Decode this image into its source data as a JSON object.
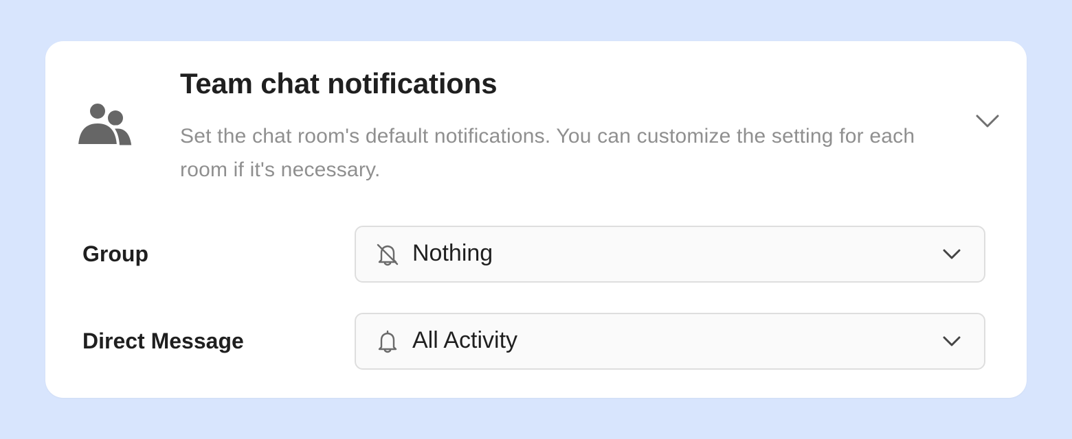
{
  "card": {
    "icon": "team-people-icon",
    "title": "Team chat notifications",
    "description": "Set the chat room's default notifications. You can customize the setting for each room if it's necessary.",
    "collapse_icon": "chevron-down-icon"
  },
  "settings": [
    {
      "label": "Group",
      "value": "Nothing",
      "icon": "bell-off-icon",
      "dropdown_icon": "chevron-down-icon"
    },
    {
      "label": "Direct Message",
      "value": "All Activity",
      "icon": "bell-icon",
      "dropdown_icon": "chevron-down-icon"
    }
  ],
  "colors": {
    "background": "#d8e5fd",
    "card": "#ffffff",
    "title_text": "#1f1f1f",
    "description_text": "#8f8f8f",
    "icon": "#666666",
    "select_background": "#fafafa",
    "select_border": "#dedede"
  }
}
